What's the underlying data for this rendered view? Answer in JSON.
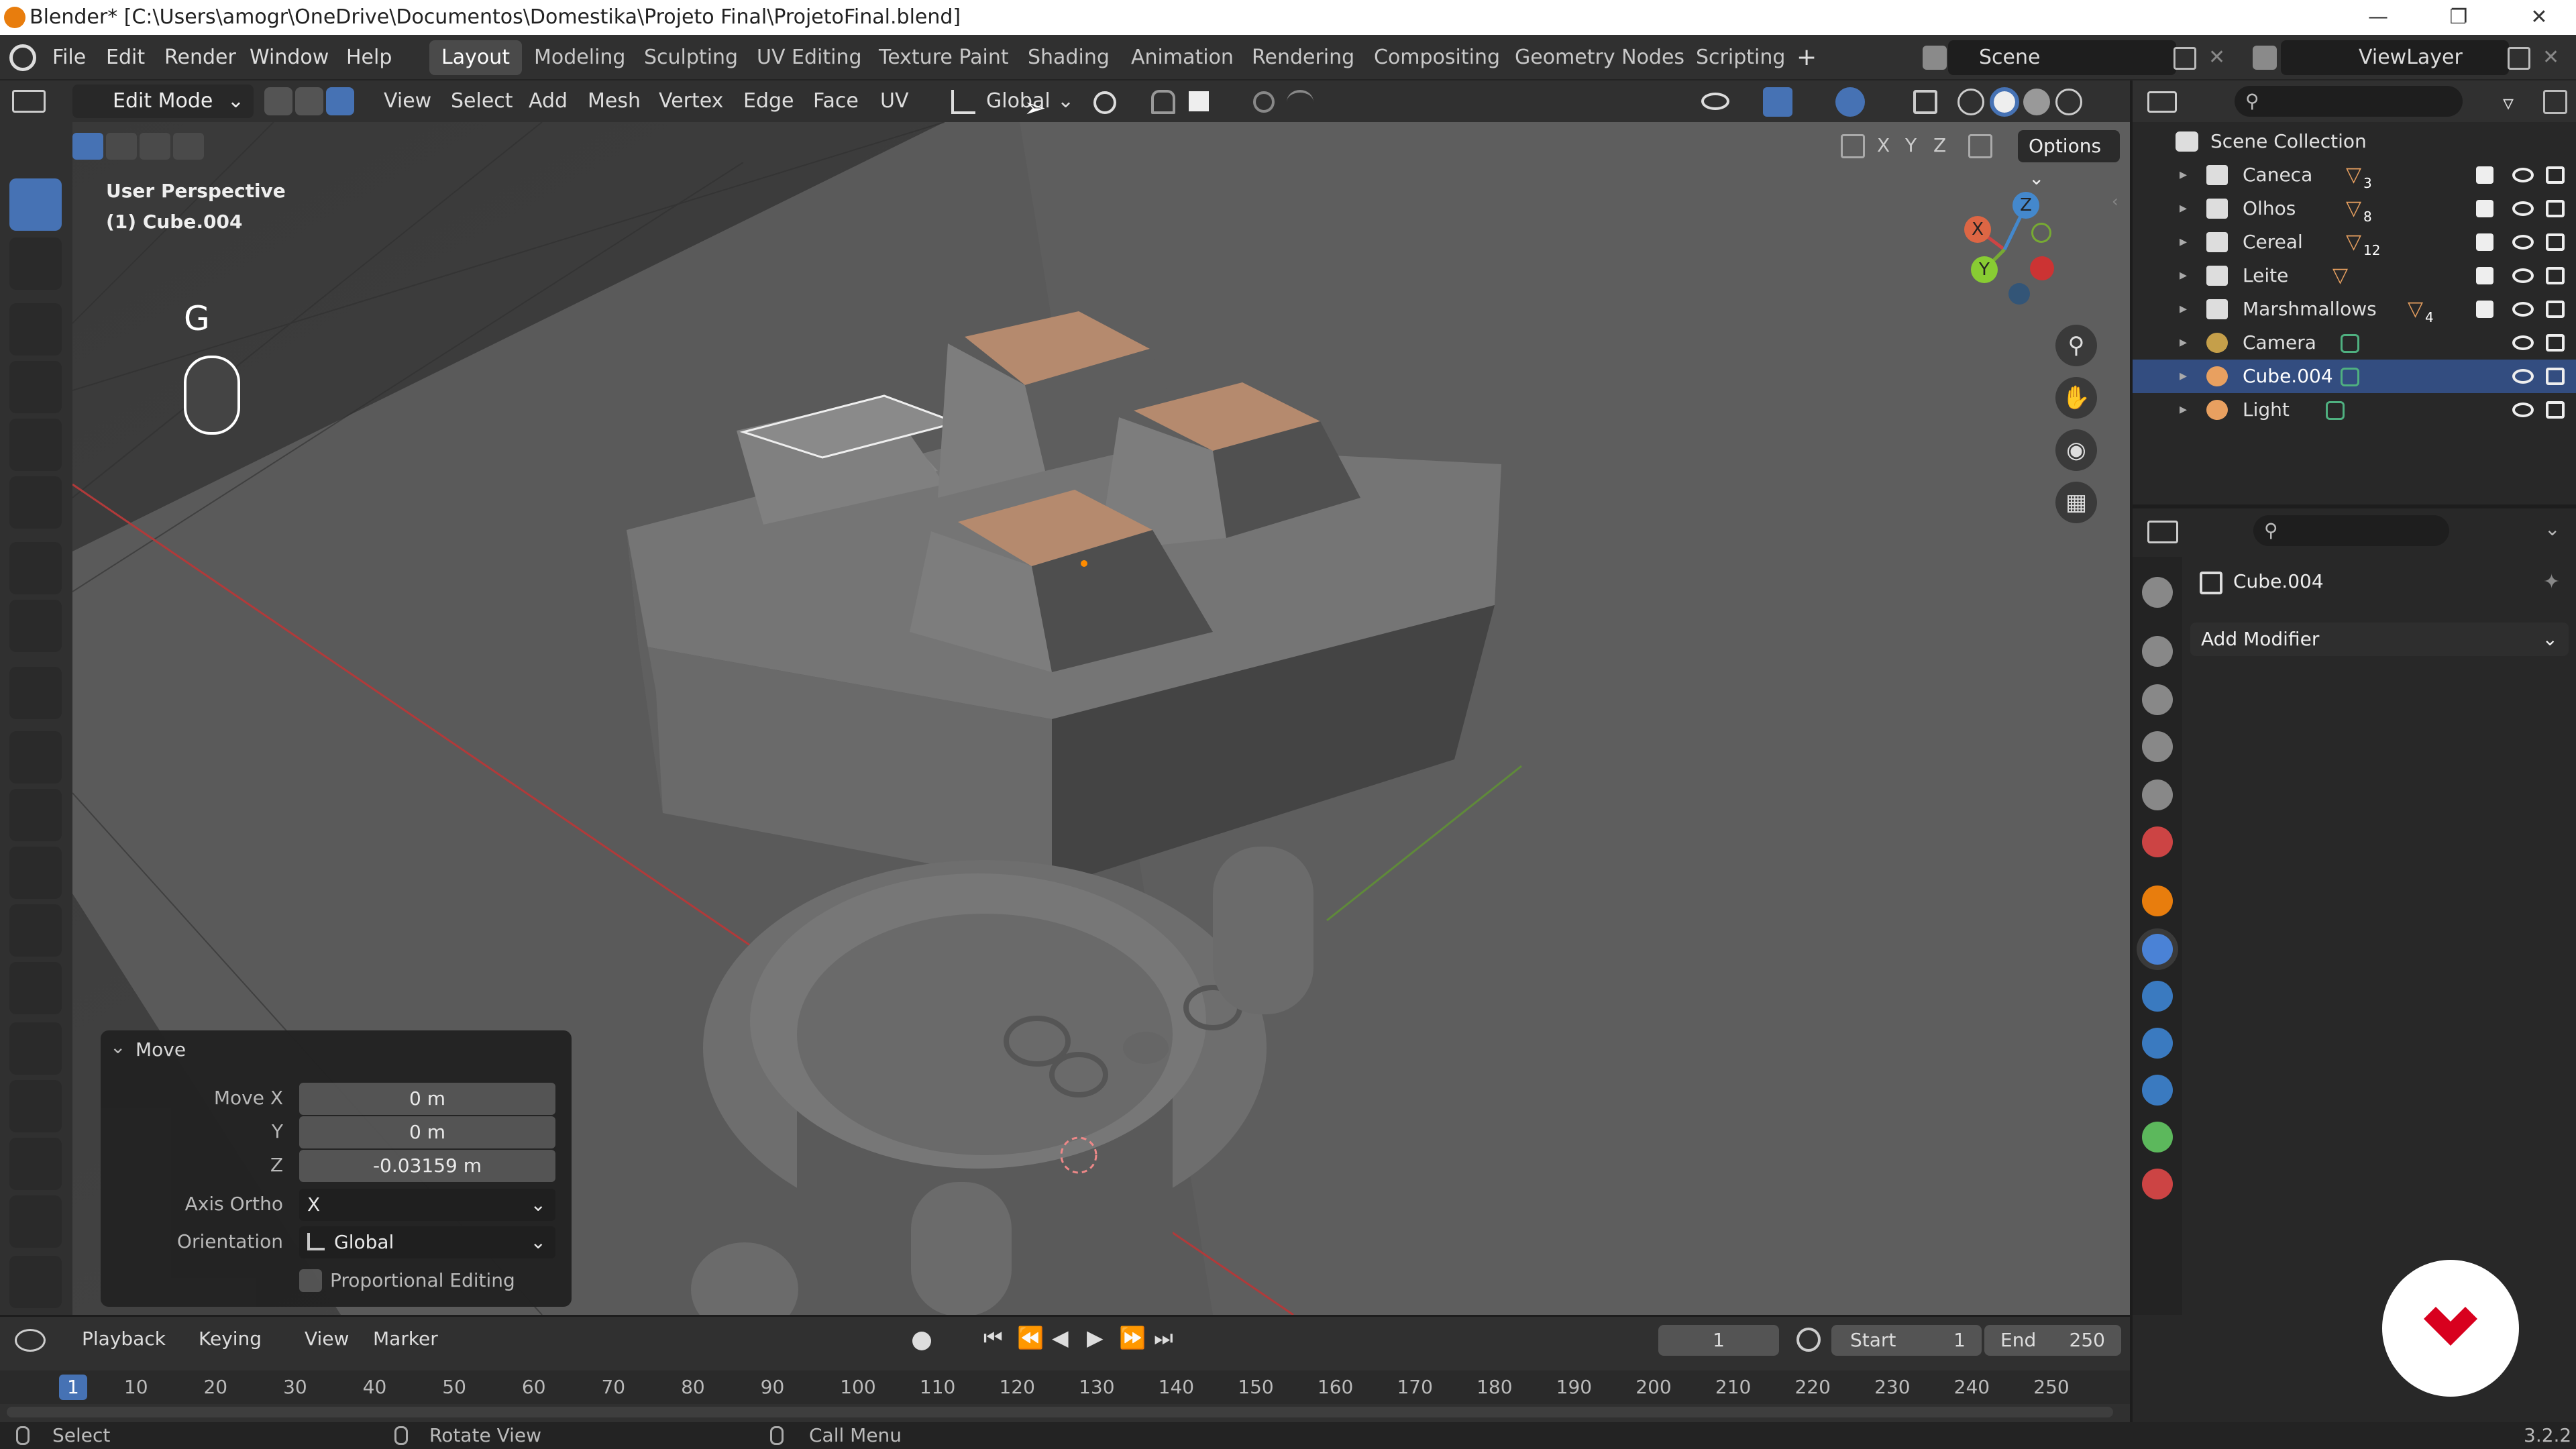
{
  "window": {
    "title": "Blender* [C:\\Users\\amogr\\OneDrive\\Documentos\\Domestika\\Projeto Final\\ProjetoFinal.blend]"
  },
  "menus": [
    "File",
    "Edit",
    "Render",
    "Window",
    "Help"
  ],
  "workspaces": [
    "Layout",
    "Modeling",
    "Sculpting",
    "UV Editing",
    "Texture Paint",
    "Shading",
    "Animation",
    "Rendering",
    "Compositing",
    "Geometry Nodes",
    "Scripting"
  ],
  "active_workspace": "Layout",
  "scene": {
    "label": "Scene"
  },
  "view_layer": {
    "label": "ViewLayer"
  },
  "header": {
    "mode": "Edit Mode",
    "menus": [
      "View",
      "Select",
      "Add",
      "Mesh",
      "Vertex",
      "Edge",
      "Face",
      "UV"
    ],
    "orientation": "Global",
    "options": "Options",
    "axes": [
      "X",
      "Y",
      "Z"
    ]
  },
  "viewport": {
    "perspective": "User Perspective",
    "object": "(1) Cube.004",
    "key": "G",
    "gizmo": {
      "x": "X",
      "y": "Y",
      "z": "Z"
    }
  },
  "move_panel": {
    "title": "Move",
    "move_x_label": "Move X",
    "move_x": "0 m",
    "y_label": "Y",
    "y": "0 m",
    "z_label": "Z",
    "z": "-0.03159 m",
    "axis_ortho_label": "Axis Ortho",
    "axis_ortho": "X",
    "orientation_label": "Orientation",
    "orientation": "Global",
    "proportional": "Proportional Editing"
  },
  "outliner": {
    "root": "Scene Collection",
    "items": [
      {
        "name": "Caneca",
        "badge": "3"
      },
      {
        "name": "Olhos",
        "badge": "8"
      },
      {
        "name": "Cereal",
        "badge": "12"
      },
      {
        "name": "Leite",
        "badge": ""
      },
      {
        "name": "Marshmallows",
        "badge": "4"
      },
      {
        "name": "Camera",
        "badge": ""
      },
      {
        "name": "Cube.004",
        "badge": ""
      },
      {
        "name": "Light",
        "badge": ""
      }
    ]
  },
  "properties": {
    "object": "Cube.004",
    "add_modifier": "Add Modifier"
  },
  "timeline": {
    "menus": [
      "Playback",
      "Keying",
      "View",
      "Marker"
    ],
    "current_frame": "1",
    "start_label": "Start",
    "start": "1",
    "end_label": "End",
    "end": "250",
    "ticks": [
      "1",
      "10",
      "20",
      "30",
      "40",
      "50",
      "60",
      "70",
      "80",
      "90",
      "100",
      "110",
      "120",
      "130",
      "140",
      "150",
      "160",
      "170",
      "180",
      "190",
      "200",
      "210",
      "220",
      "230",
      "240",
      "250"
    ]
  },
  "status": {
    "select": "Select",
    "rotate": "Rotate View",
    "menu": "Call Menu",
    "version": "3.2.2"
  },
  "colors": {
    "accent": "#4672b4",
    "selected_face": "#b58a6e",
    "logo": "#d8001e"
  }
}
